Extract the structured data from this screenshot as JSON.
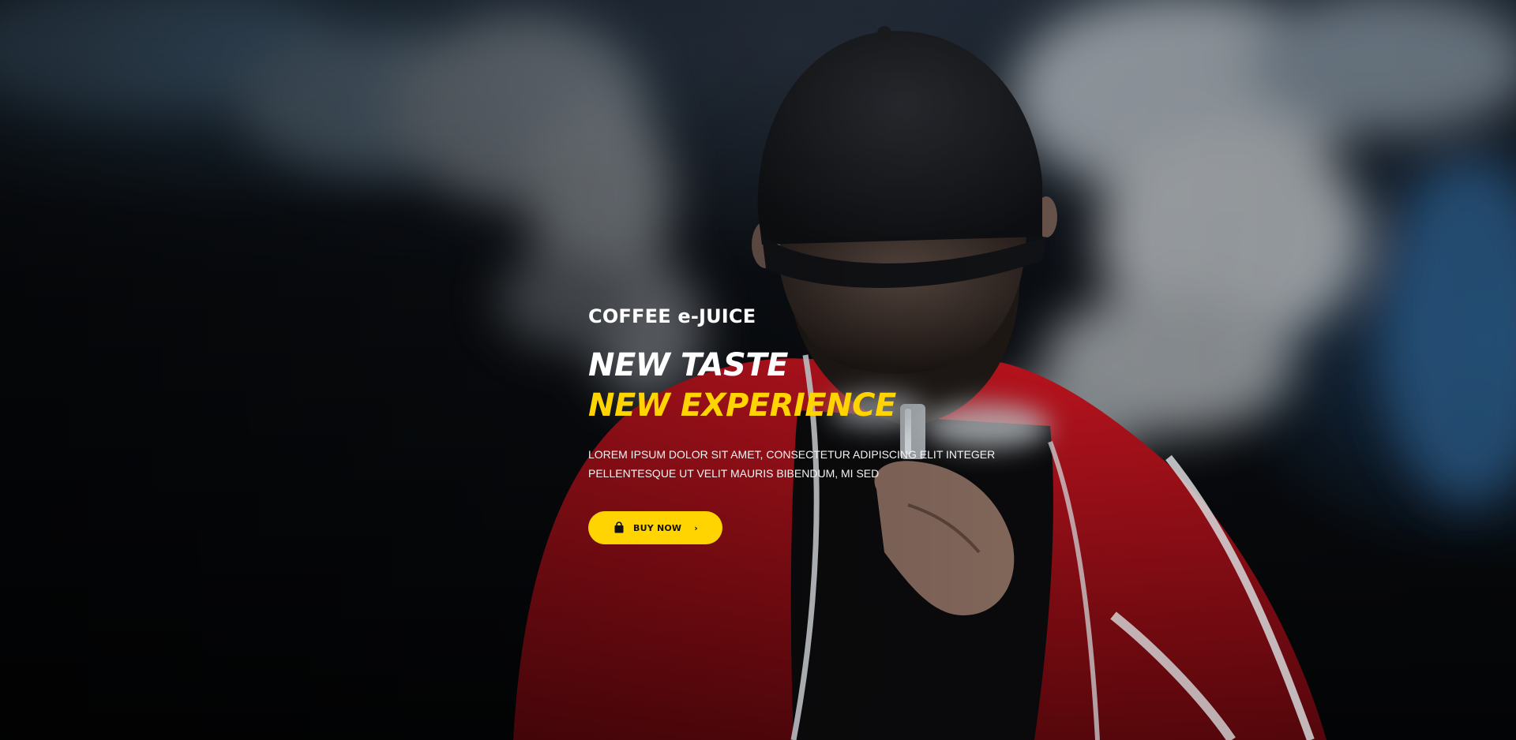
{
  "hero": {
    "eyebrow": "COFFEE e-JUICE",
    "headline_line1": "NEW TASTE",
    "headline_line2": "NEW EXPERIENCE",
    "description_line1": "LOREM IPSUM DOLOR SIT AMET, CONSECTETUR ADIPISCING ELIT INTEGER",
    "description_line2": "PELLENTESQUE UT VELIT MAURIS BIBENDUM, MI SED",
    "cta": {
      "label": "BUY NOW",
      "icon": "shopping-bag-icon",
      "arrow": "›",
      "arrow_icon": "chevron-right-icon"
    }
  },
  "colors": {
    "accent": "#ffd400",
    "text": "#ffffff",
    "jacket": "#b0121c",
    "background": "#05070a"
  }
}
